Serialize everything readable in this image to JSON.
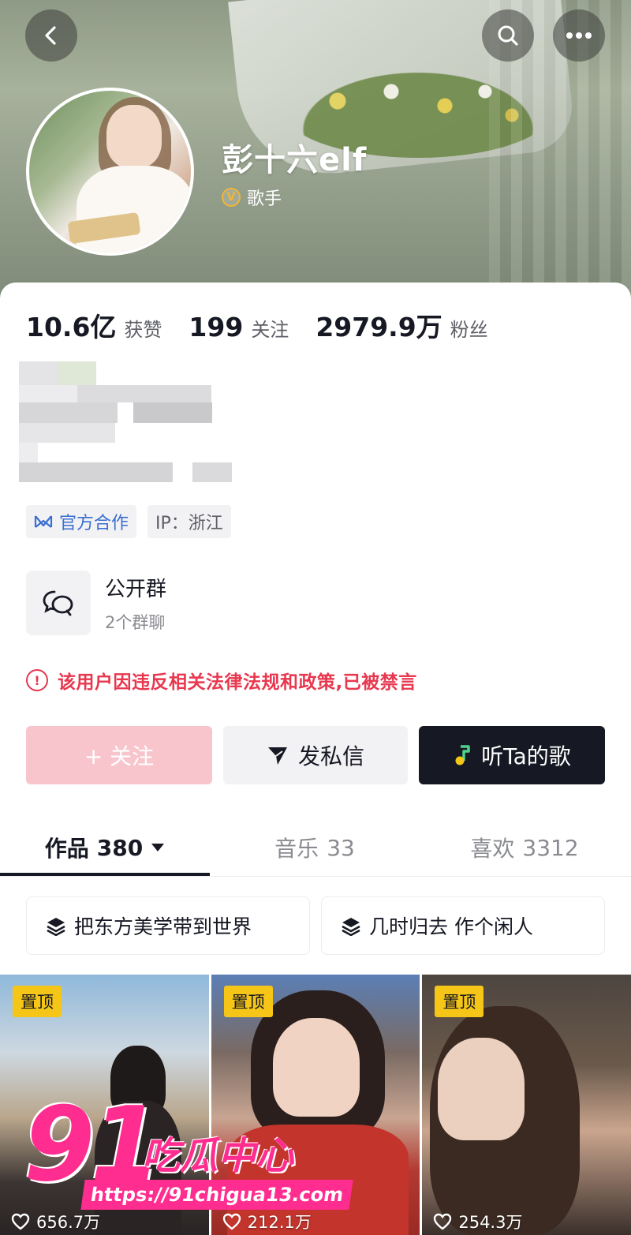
{
  "header": {
    "nickname": "彭十六elf",
    "verify_badge": "V",
    "verify_label": "歌手",
    "icons": {
      "back": "back-arrow-icon",
      "search": "search-icon",
      "more": "more-dots-icon"
    }
  },
  "stats": {
    "likes_value": "10.6亿",
    "likes_label": "获赞",
    "following_value": "199",
    "following_label": "关注",
    "followers_value": "2979.9万",
    "followers_label": "粉丝"
  },
  "tags": {
    "official": "官方合作",
    "ip": "IP：浙江"
  },
  "group": {
    "title": "公开群",
    "subtitle": "2个群聊"
  },
  "notice": {
    "icon": "!",
    "text": "该用户因违反相关法律法规和政策,已被禁言"
  },
  "actions": {
    "follow": "+ 关注",
    "message": "发私信",
    "listen": "听Ta的歌"
  },
  "tabs": [
    {
      "label": "作品",
      "count": "380"
    },
    {
      "label": "音乐",
      "count": "33"
    },
    {
      "label": "喜欢",
      "count": "3312"
    }
  ],
  "collections": [
    {
      "label": "把东方美学带到世界"
    },
    {
      "label": "几时归去 作个闲人"
    }
  ],
  "videos": [
    {
      "pin": "置顶",
      "likes": "656.7万"
    },
    {
      "pin": "置顶",
      "likes": "212.1万"
    },
    {
      "pin": "置顶",
      "likes": "254.3万"
    }
  ],
  "watermark": {
    "number": "91",
    "name": "吃瓜中心",
    "url": "https://91chigua13.com"
  },
  "colors": {
    "danger": "#e8374e",
    "follow_disabled": "#f8c5cd",
    "dark_button": "#161823",
    "pin_badge": "#f5c518",
    "official_blue": "#3b6fd1",
    "watermark_pink": "#ff2d8f"
  }
}
